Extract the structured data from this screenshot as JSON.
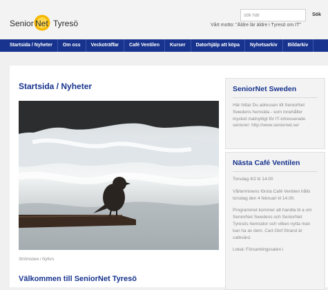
{
  "brand": {
    "logo_text_left": "Senior",
    "logo_text_mid": "Net",
    "logo_text_right": "Tyresö"
  },
  "search": {
    "placeholder": "sök här",
    "button_label": "Sök"
  },
  "motto": "Vårt motto: \"Äldre lär äldre i Tyresö om IT\"",
  "nav": {
    "items": [
      "Startsida / Nyheter",
      "Om oss",
      "Veckoträffar",
      "Café Ventilen",
      "Kurser",
      "Datorhjälp att köpa",
      "Nyhetsarkiv",
      "Bildarkiv"
    ]
  },
  "main": {
    "title": "Startsida / Nyheter",
    "image_caption": "Strömstare i Nyfors",
    "welcome_title": "Välkommen till SeniorNet Tyresö"
  },
  "sidebar": {
    "card1": {
      "title": "SeniorNet Sweden",
      "text": "Här hittar Du adressen till SeniorNet Swedens hemsida - som innehåller mycket matnyttigt för IT-intresserade seniorer: http://www.seniornet.se/"
    },
    "card2": {
      "title": "Nästa Café Ventilen",
      "p1": "Torsdag 4/2 kl 14.00",
      "p2": "Vårterminens första Café Ventilen hålls torsdag den 4 februari kl 14.00.",
      "p3": "Programmet kommer att handla bl a om SeniorNet Swedens och SeniorNet Tyresös hemsidor och vilken nytta man kan ha av dem. Carl-Olof Strand är cafévärd.",
      "p4": "Lokal: Församlingssalen i"
    }
  },
  "colors": {
    "primary": "#17338e",
    "logo_accent": "#f2a900",
    "muted_text": "#8a8a8a"
  }
}
